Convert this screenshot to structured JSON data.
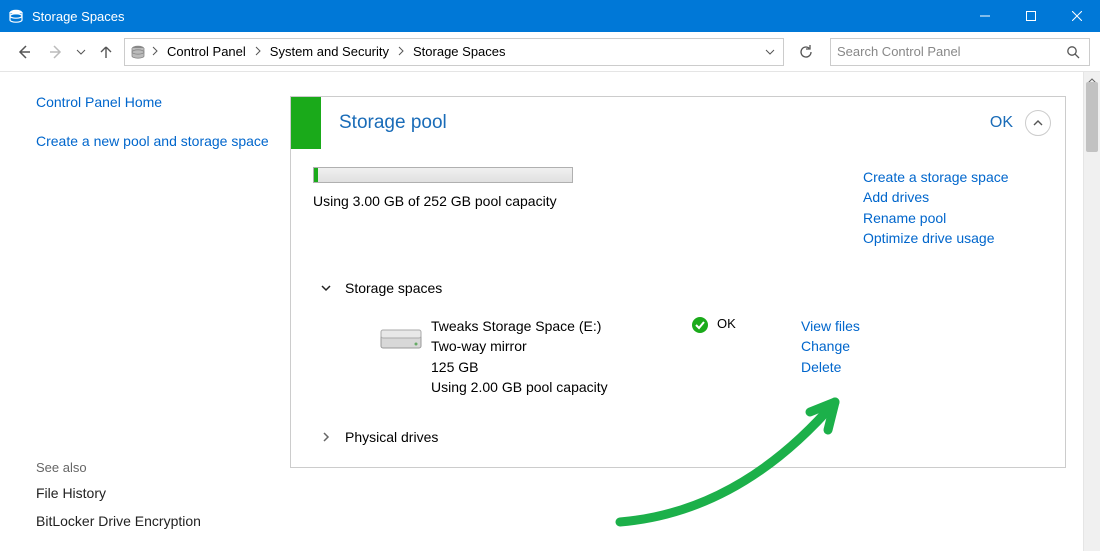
{
  "window": {
    "title": "Storage Spaces"
  },
  "nav": {
    "breadcrumb": [
      "Control Panel",
      "System and Security",
      "Storage Spaces"
    ],
    "search_placeholder": "Search Control Panel"
  },
  "sidebar": {
    "home": "Control Panel Home",
    "create_pool": "Create a new pool and storage space",
    "see_also_label": "See also",
    "file_history": "File History",
    "bitlocker": "BitLocker Drive Encryption"
  },
  "pool": {
    "title": "Storage pool",
    "status": "OK",
    "usage_text": "Using 3.00 GB of 252 GB pool capacity",
    "actions": {
      "create_space": "Create a storage space",
      "add_drives": "Add drives",
      "rename_pool": "Rename pool",
      "optimize": "Optimize drive usage"
    },
    "sections": {
      "storage_spaces_label": "Storage spaces",
      "physical_drives_label": "Physical drives"
    },
    "space": {
      "name": "Tweaks Storage Space (E:)",
      "type": "Two-way mirror",
      "size": "125 GB",
      "usage": "Using 2.00 GB pool capacity",
      "status": "OK",
      "actions": {
        "view_files": "View files",
        "change": "Change",
        "delete": "Delete"
      }
    }
  }
}
